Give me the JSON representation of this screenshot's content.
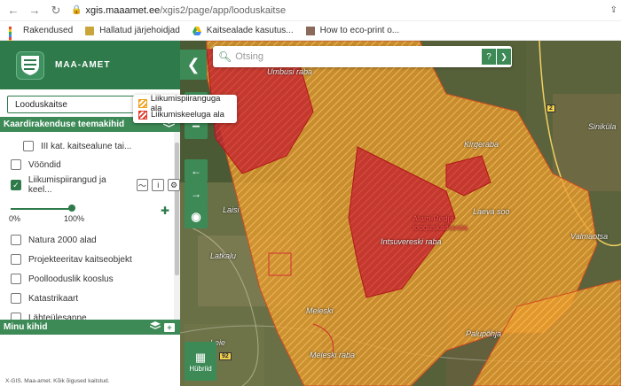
{
  "browser": {
    "url_host": "xgis.maaamet.ee",
    "url_path": "/xgis2/page/app/looduskaitse",
    "bookmarks": [
      {
        "label": "Rakendused",
        "icon": "apps-grid-icon"
      },
      {
        "label": "Hallatud järjehoidjad",
        "icon": "folder-icon"
      },
      {
        "label": "Kaitsealade kasutus...",
        "icon": "drive-icon"
      },
      {
        "label": "How to eco-print o...",
        "icon": "image-icon"
      }
    ]
  },
  "sidebar": {
    "brand_name": "MAA-AMET",
    "theme_select": "Looduskaitse",
    "section_title": "Kaardirakenduse teemakihid",
    "layers": [
      {
        "label": "III kat. kaitsealune tai...",
        "checked": false
      },
      {
        "label": "Vööndid",
        "checked": false
      },
      {
        "label": "Liikumispiirangud ja keel...",
        "checked": true
      },
      {
        "label": "Natura 2000 alad",
        "checked": false
      },
      {
        "label": "Projekteeritav kaitseobjekt",
        "checked": false
      },
      {
        "label": "Poollooduslik kooslus",
        "checked": false
      },
      {
        "label": "Katastrikaart",
        "checked": false
      },
      {
        "label": "Lähteülesanne",
        "checked": false
      }
    ],
    "opacity_min": "0%",
    "opacity_max": "100%",
    "opacity_value": 1.0,
    "legend": [
      {
        "label": "Liikumispiiranguga ala",
        "color": "#f0a21c"
      },
      {
        "label": "Liikumiskeeluga ala",
        "color": "#e0392b"
      }
    ],
    "my_layers_title": "Minu kihid",
    "copyright": "X-GIS. Maa-amet. Kõik õigused kaitstud."
  },
  "map": {
    "search_placeholder": "Otsing",
    "help_label": "?",
    "basemap_label": "Hübriid",
    "place_names": {
      "umbusi": "Umbusi raba",
      "kirgeraba": "Kirgeraba",
      "laeva_soo": "Laeva soo",
      "alam_pedja_1": "Alam-Pedja",
      "alam_pedja_2": "looduskaitseala",
      "intsuvere": "Intsuvereski raba",
      "laisi": "Laisi",
      "latkalu": "Latkalu",
      "meleski": "Meleski",
      "meleski_raba": "Meleski raba",
      "paluphja": "Palupõhja",
      "sinikula": "Siniküla",
      "valmaotsa": "Valmaotsa",
      "leie": "Leie"
    },
    "road_labels": [
      "2",
      "92"
    ],
    "colors": {
      "restricted": "#f0a21c",
      "prohibited": "#e0392b",
      "accent": "#3d8a57"
    }
  }
}
